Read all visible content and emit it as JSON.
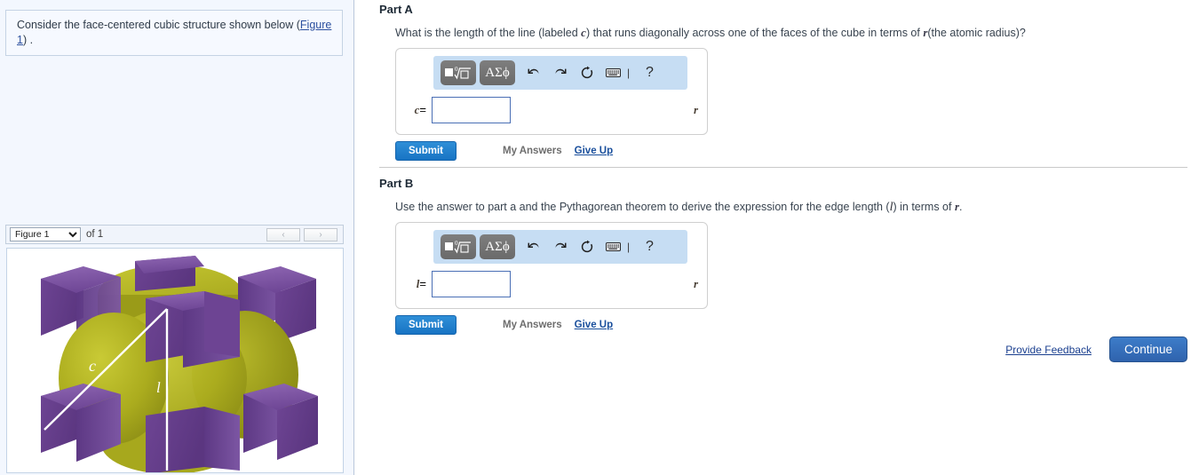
{
  "left_panel": {
    "intro": {
      "text_before": "Consider the face-centered cubic structure shown below (",
      "link_label": "Figure 1",
      "text_after": ") ."
    },
    "figure_nav": {
      "selected_figure": "Figure 1",
      "options": [
        "Figure 1"
      ],
      "count_label": "of 1",
      "prev_label": "‹",
      "next_label": "›"
    },
    "figure": {
      "caption_c": "c",
      "caption_l": "l",
      "corner_atom_color": "#7a4f9e",
      "face_atom_color": "#b2b320",
      "line_color": "#ffffff"
    }
  },
  "parts": [
    {
      "heading": "Part A",
      "prompt_1": "What is the length of the line (labeled ",
      "prompt_var": "c",
      "prompt_2": ") that runs diagonally across one of the faces of the cube in terms of ",
      "prompt_var2": "r",
      "prompt_3": "(the atomic radius)?",
      "answer_label": "c",
      "answer_eq": "=",
      "answer_value": "",
      "answer_unit": "r",
      "toolbar": {
        "template_button": "■√",
        "symbol_button": "ΑΣϕ",
        "undo_icon": "undo-icon",
        "redo_icon": "redo-icon",
        "reset_icon": "reset-icon",
        "keyboard_icon": "keyboard-icon",
        "help_icon": "?"
      },
      "submit_label": "Submit",
      "my_answers_label": "My Answers",
      "give_up_label": "Give Up"
    },
    {
      "heading": "Part B",
      "prompt_1": "Use the answer to part a and the Pythagorean theorem to derive the expression for the edge length (",
      "prompt_var": "l",
      "prompt_2": ") in terms of ",
      "prompt_var2": "r",
      "prompt_3": ".",
      "answer_label": "l",
      "answer_eq": "=",
      "answer_value": "",
      "answer_unit": "r",
      "toolbar": {
        "template_button": "■√",
        "symbol_button": "ΑΣϕ",
        "undo_icon": "undo-icon",
        "redo_icon": "redo-icon",
        "reset_icon": "reset-icon",
        "keyboard_icon": "keyboard-icon",
        "help_icon": "?"
      },
      "submit_label": "Submit",
      "my_answers_label": "My Answers",
      "give_up_label": "Give Up"
    }
  ],
  "footer": {
    "feedback_label": "Provide Feedback",
    "continue_label": "Continue"
  },
  "colors": {
    "submit_blue": "#1874c4",
    "link_blue": "#1a4f9c",
    "toolbar_blue": "#c6ddf3",
    "panel_bg": "#f3f7fe"
  }
}
